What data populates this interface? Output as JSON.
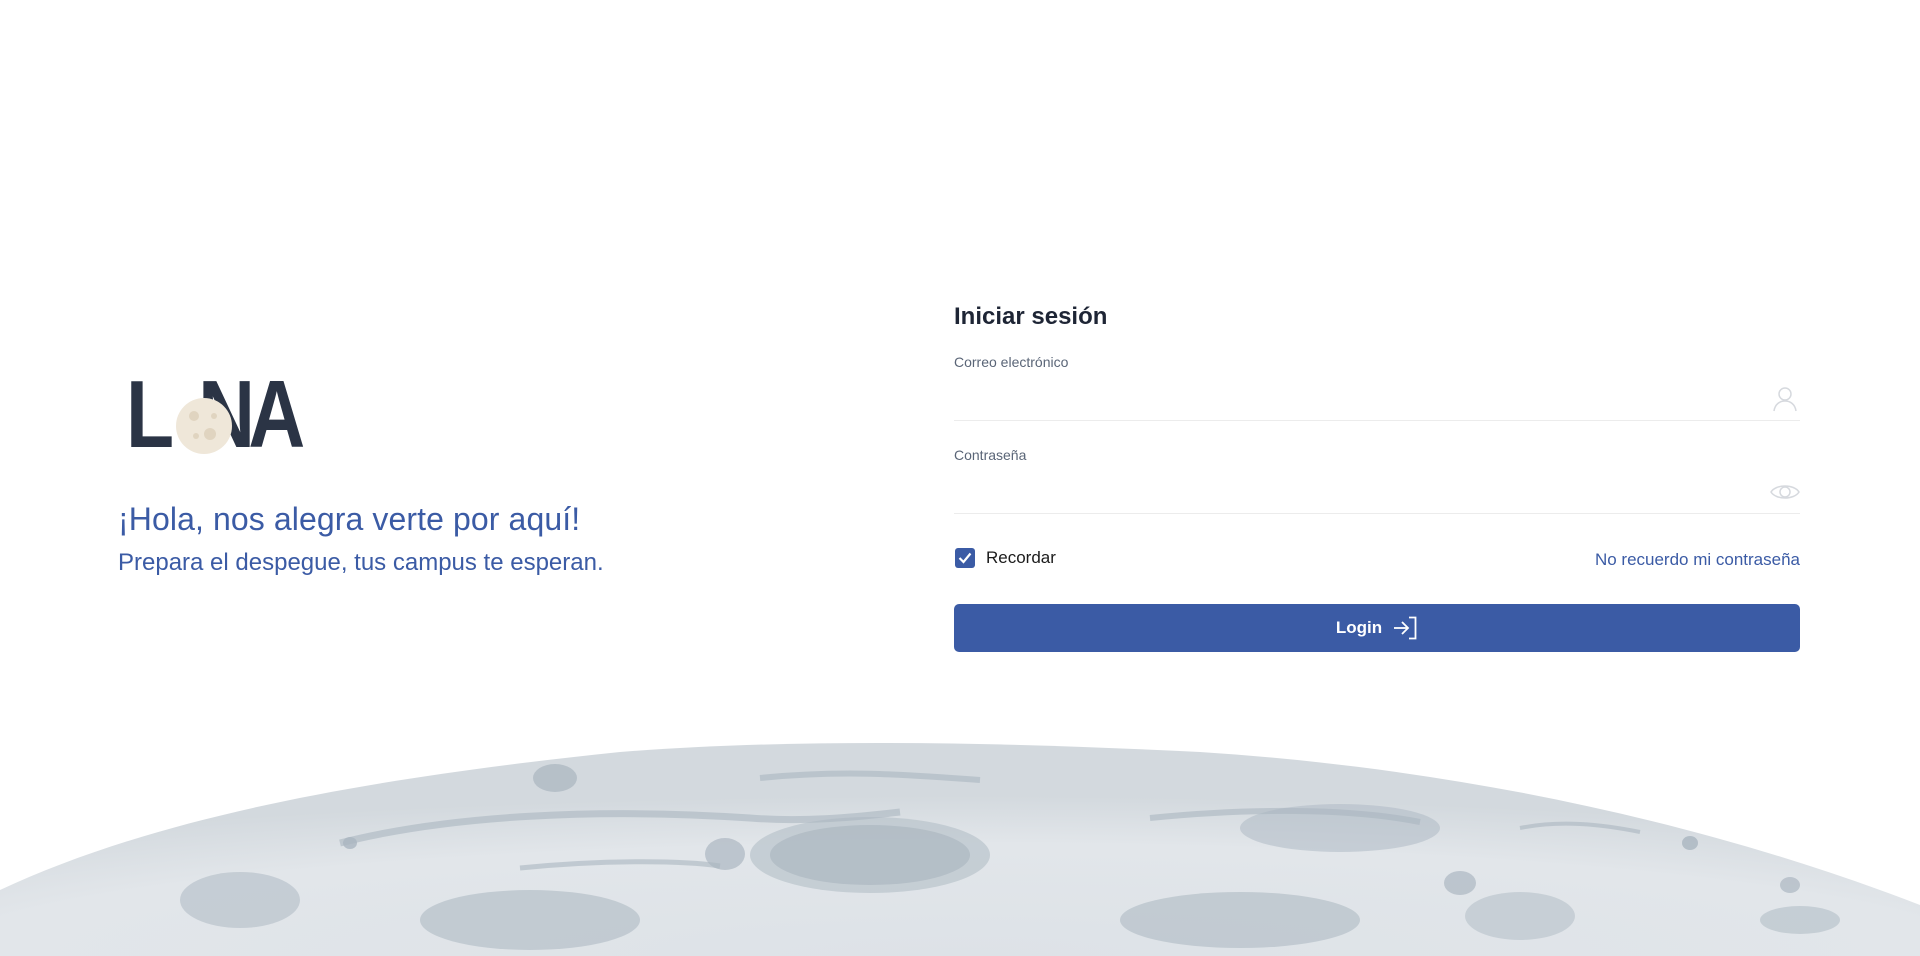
{
  "brand": {
    "logo_text": "LUNA",
    "greeting": "¡Hola, nos alegra verte por aquí!",
    "subgreeting": "Prepara el despegue, tus campus te esperan.",
    "logo_color": "#2b3445",
    "accent_color": "#3b5ba5"
  },
  "login_form": {
    "title": "Iniciar sesión",
    "email": {
      "label": "Correo electrónico",
      "value": "",
      "icon": "user-icon"
    },
    "password": {
      "label": "Contraseña",
      "value": "",
      "icon": "eye-icon"
    },
    "remember": {
      "label": "Recordar",
      "checked": true
    },
    "forgot_link": "No recuerdo mi contraseña",
    "submit": {
      "label": "Login",
      "icon": "login-arrow-icon"
    }
  }
}
